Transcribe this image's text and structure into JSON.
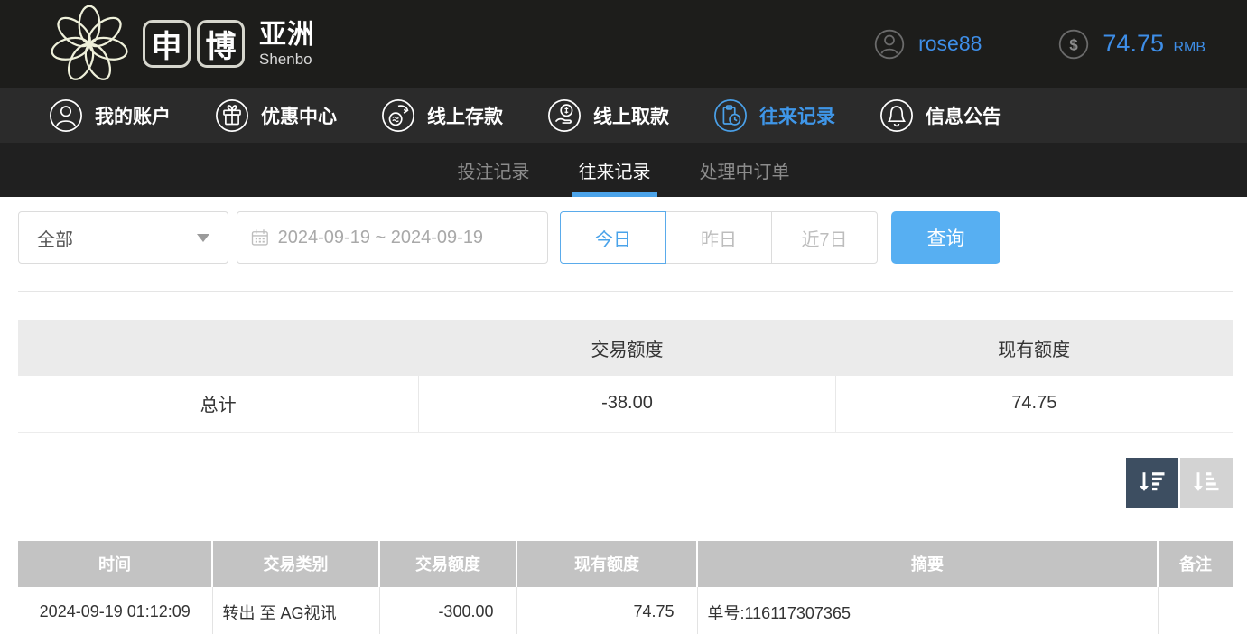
{
  "header": {
    "logo": {
      "box1": "申",
      "box2": "博",
      "region": "亚洲",
      "subtitle": "Shenbo"
    },
    "user": {
      "name": "rose88"
    },
    "balance": {
      "amount": "74.75",
      "currency": "RMB"
    }
  },
  "nav": {
    "items": [
      {
        "label": "我的账户",
        "icon": "user-icon",
        "active": false
      },
      {
        "label": "优惠中心",
        "icon": "gift-icon",
        "active": false
      },
      {
        "label": "线上存款",
        "icon": "deposit-icon",
        "active": false
      },
      {
        "label": "线上取款",
        "icon": "withdraw-icon",
        "active": false
      },
      {
        "label": "往来记录",
        "icon": "transfer-records-icon",
        "active": true
      },
      {
        "label": "信息公告",
        "icon": "bell-icon",
        "active": false
      }
    ]
  },
  "subnav": {
    "tabs": [
      {
        "label": "投注记录",
        "active": false
      },
      {
        "label": "往来记录",
        "active": true
      },
      {
        "label": "处理中订单",
        "active": false
      }
    ]
  },
  "filters": {
    "type_select": {
      "value": "全部"
    },
    "date_range": {
      "value": "2024-09-19 ~ 2024-09-19"
    },
    "quick_buttons": [
      {
        "label": "今日",
        "active": true
      },
      {
        "label": "昨日",
        "active": false
      },
      {
        "label": "近7日",
        "active": false
      }
    ],
    "search_label": "查询"
  },
  "summary_table": {
    "headers": {
      "col1": "",
      "col2": "交易额度",
      "col3": "现有额度"
    },
    "row": {
      "label": "总计",
      "transaction_amount": "-38.00",
      "current_balance": "74.75"
    }
  },
  "records_table": {
    "headers": {
      "time": "时间",
      "type": "交易类别",
      "amount": "交易额度",
      "balance": "现有额度",
      "summary": "摘要",
      "remark": "备注"
    },
    "rows": [
      {
        "time": "2024-09-19 01:12:09",
        "type": "转出 至 AG视讯",
        "amount": "-300.00",
        "balance": "74.75",
        "summary": "单号:116117307365",
        "remark": ""
      }
    ]
  },
  "colors": {
    "accent_blue": "#3e8ee8",
    "button_blue": "#57aff2",
    "underline_blue": "#4ba3e9",
    "header_bg": "#1d1d1b",
    "nav_bg": "#2b2b2b",
    "subnav_bg": "#202020",
    "summary_header_bg": "#ebebeb",
    "table_header_bg": "#c3c3c3",
    "sort_active_bg": "#3d4e61",
    "sort_inactive_bg": "#d3d3d3"
  }
}
